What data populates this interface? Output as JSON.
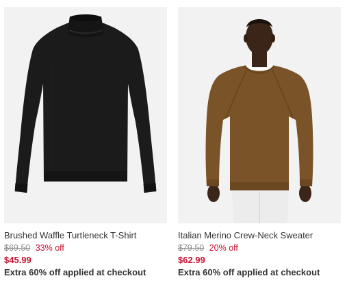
{
  "products": [
    {
      "name": "Brushed Waffle Turtleneck T-Shirt",
      "original_price": "$69.50",
      "discount": "33% off",
      "sale_price": "$45.99",
      "promo": "Extra 60% off applied at checkout",
      "image_color": "#1a1a1a"
    },
    {
      "name": "Italian Merino Crew-Neck Sweater",
      "original_price": "$79.50",
      "discount": "20% off",
      "sale_price": "$62.99",
      "promo": "Extra 60% off applied at checkout",
      "image_color": "#7a5428"
    }
  ],
  "colors": {
    "sale_red": "#c8102e",
    "image_bg": "#f2f2f2"
  }
}
